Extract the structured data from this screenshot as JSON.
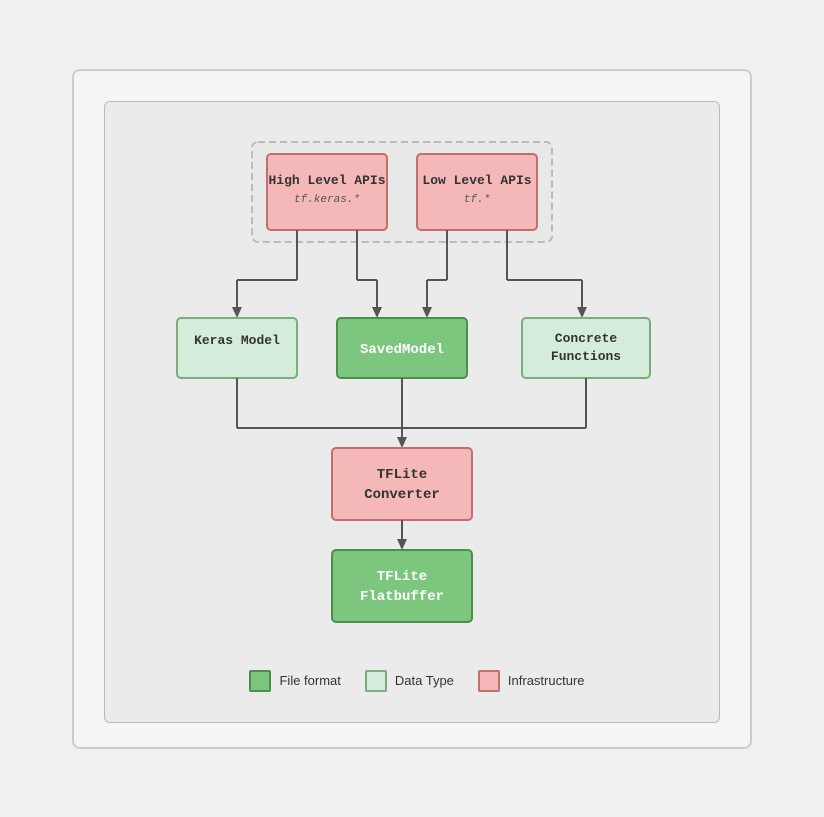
{
  "diagram": {
    "top_group": {
      "boxes": [
        {
          "id": "high-level-apis",
          "label": "High Level APIs",
          "sub": "tf.keras.*",
          "style": "pink"
        },
        {
          "id": "low-level-apis",
          "label": "Low Level APIs",
          "sub": "tf.*",
          "style": "pink"
        }
      ]
    },
    "mid_row": {
      "boxes": [
        {
          "id": "keras-model",
          "label": "Keras Model",
          "style": "light-green"
        },
        {
          "id": "saved-model",
          "label": "SavedModel",
          "style": "dark-green"
        },
        {
          "id": "concrete-functions",
          "label": "Concrete\nFunctions",
          "style": "light-green"
        }
      ]
    },
    "bottom_boxes": [
      {
        "id": "tflite-converter",
        "label": "TFLite\nConverter",
        "style": "pink"
      },
      {
        "id": "tflite-flatbuffer",
        "label": "TFLite\nFlatbuffer",
        "style": "dark-green"
      }
    ]
  },
  "legend": {
    "items": [
      {
        "id": "file-format",
        "label": "File format",
        "swatch": "green"
      },
      {
        "id": "data-type",
        "label": "Data Type",
        "swatch": "light-green"
      },
      {
        "id": "infrastructure",
        "label": "Infrastructure",
        "swatch": "pink"
      }
    ]
  }
}
